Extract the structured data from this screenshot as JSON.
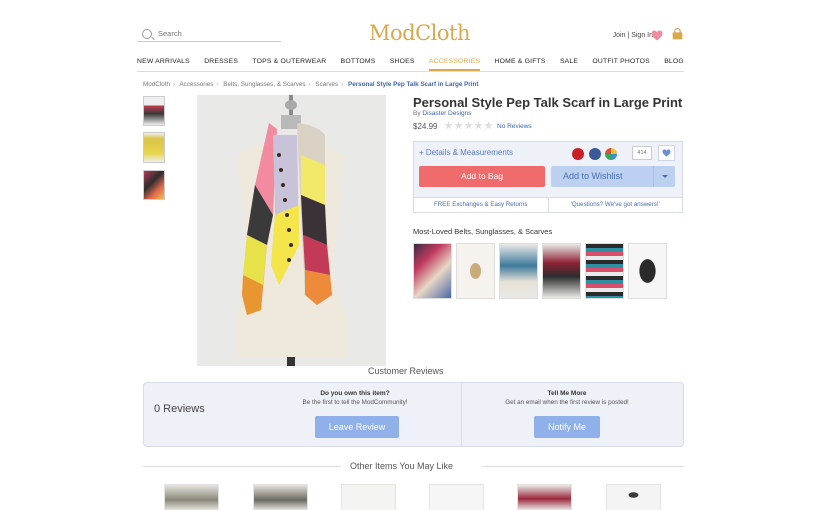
{
  "header": {
    "search_placeholder": "Search",
    "logo": "ModCloth",
    "account": "Join | Sign In",
    "icons": {
      "wishlist": "heart-icon",
      "bag": "bag-icon",
      "search": "search-icon"
    },
    "accent": "#d9a94c"
  },
  "nav": [
    "NEW ARRIVALS",
    "DRESSES",
    "TOPS & OUTERWEAR",
    "BOTTOMS",
    "SHOES",
    "ACCESSORIES",
    "HOME & GIFTS",
    "SALE",
    "OUTFIT PHOTOS",
    "BLOG"
  ],
  "nav_active": "ACCESSORIES",
  "breadcrumbs": [
    "ModCloth",
    "Accessories",
    "Belts, Sunglasses, & Scarves",
    "Scarves"
  ],
  "breadcrumb_current": "Personal Style Pep Talk Scarf in Large Print",
  "product": {
    "title": "Personal Style Pep Talk Scarf in Large Print",
    "by": "By",
    "brand": "Disaster Designs",
    "price": "$24.99",
    "rating_stars": 0,
    "rating_max": 5,
    "reviews_link": "No Reviews",
    "details_link": "+ Details & Measurements",
    "share_count": "414",
    "add_to_bag": "Add to Bag",
    "add_to_wishlist": "Add to Wishlist",
    "exchanges": "FREE Exchanges & Easy Returns",
    "questions": "Questions? We've got answers!",
    "colors": {
      "add_bag": "#f06b6b",
      "link": "#3e66b0"
    }
  },
  "most_loved": {
    "title": "Most-Loved Belts, Sunglasses, & Scarves",
    "count": 6
  },
  "reviews": {
    "title": "Customer Reviews",
    "count": "0 Reviews",
    "own_head": "Do you own this item?",
    "own_sub": "Be the first to tell the ModCommunity!",
    "leave_btn": "Leave Review",
    "tell_head": "Tell Me More",
    "tell_sub": "Get an email when the first review is posted!",
    "notify_btn": "Notify Me"
  },
  "other_items": {
    "title": "Other Items You May Like",
    "count": 6
  }
}
